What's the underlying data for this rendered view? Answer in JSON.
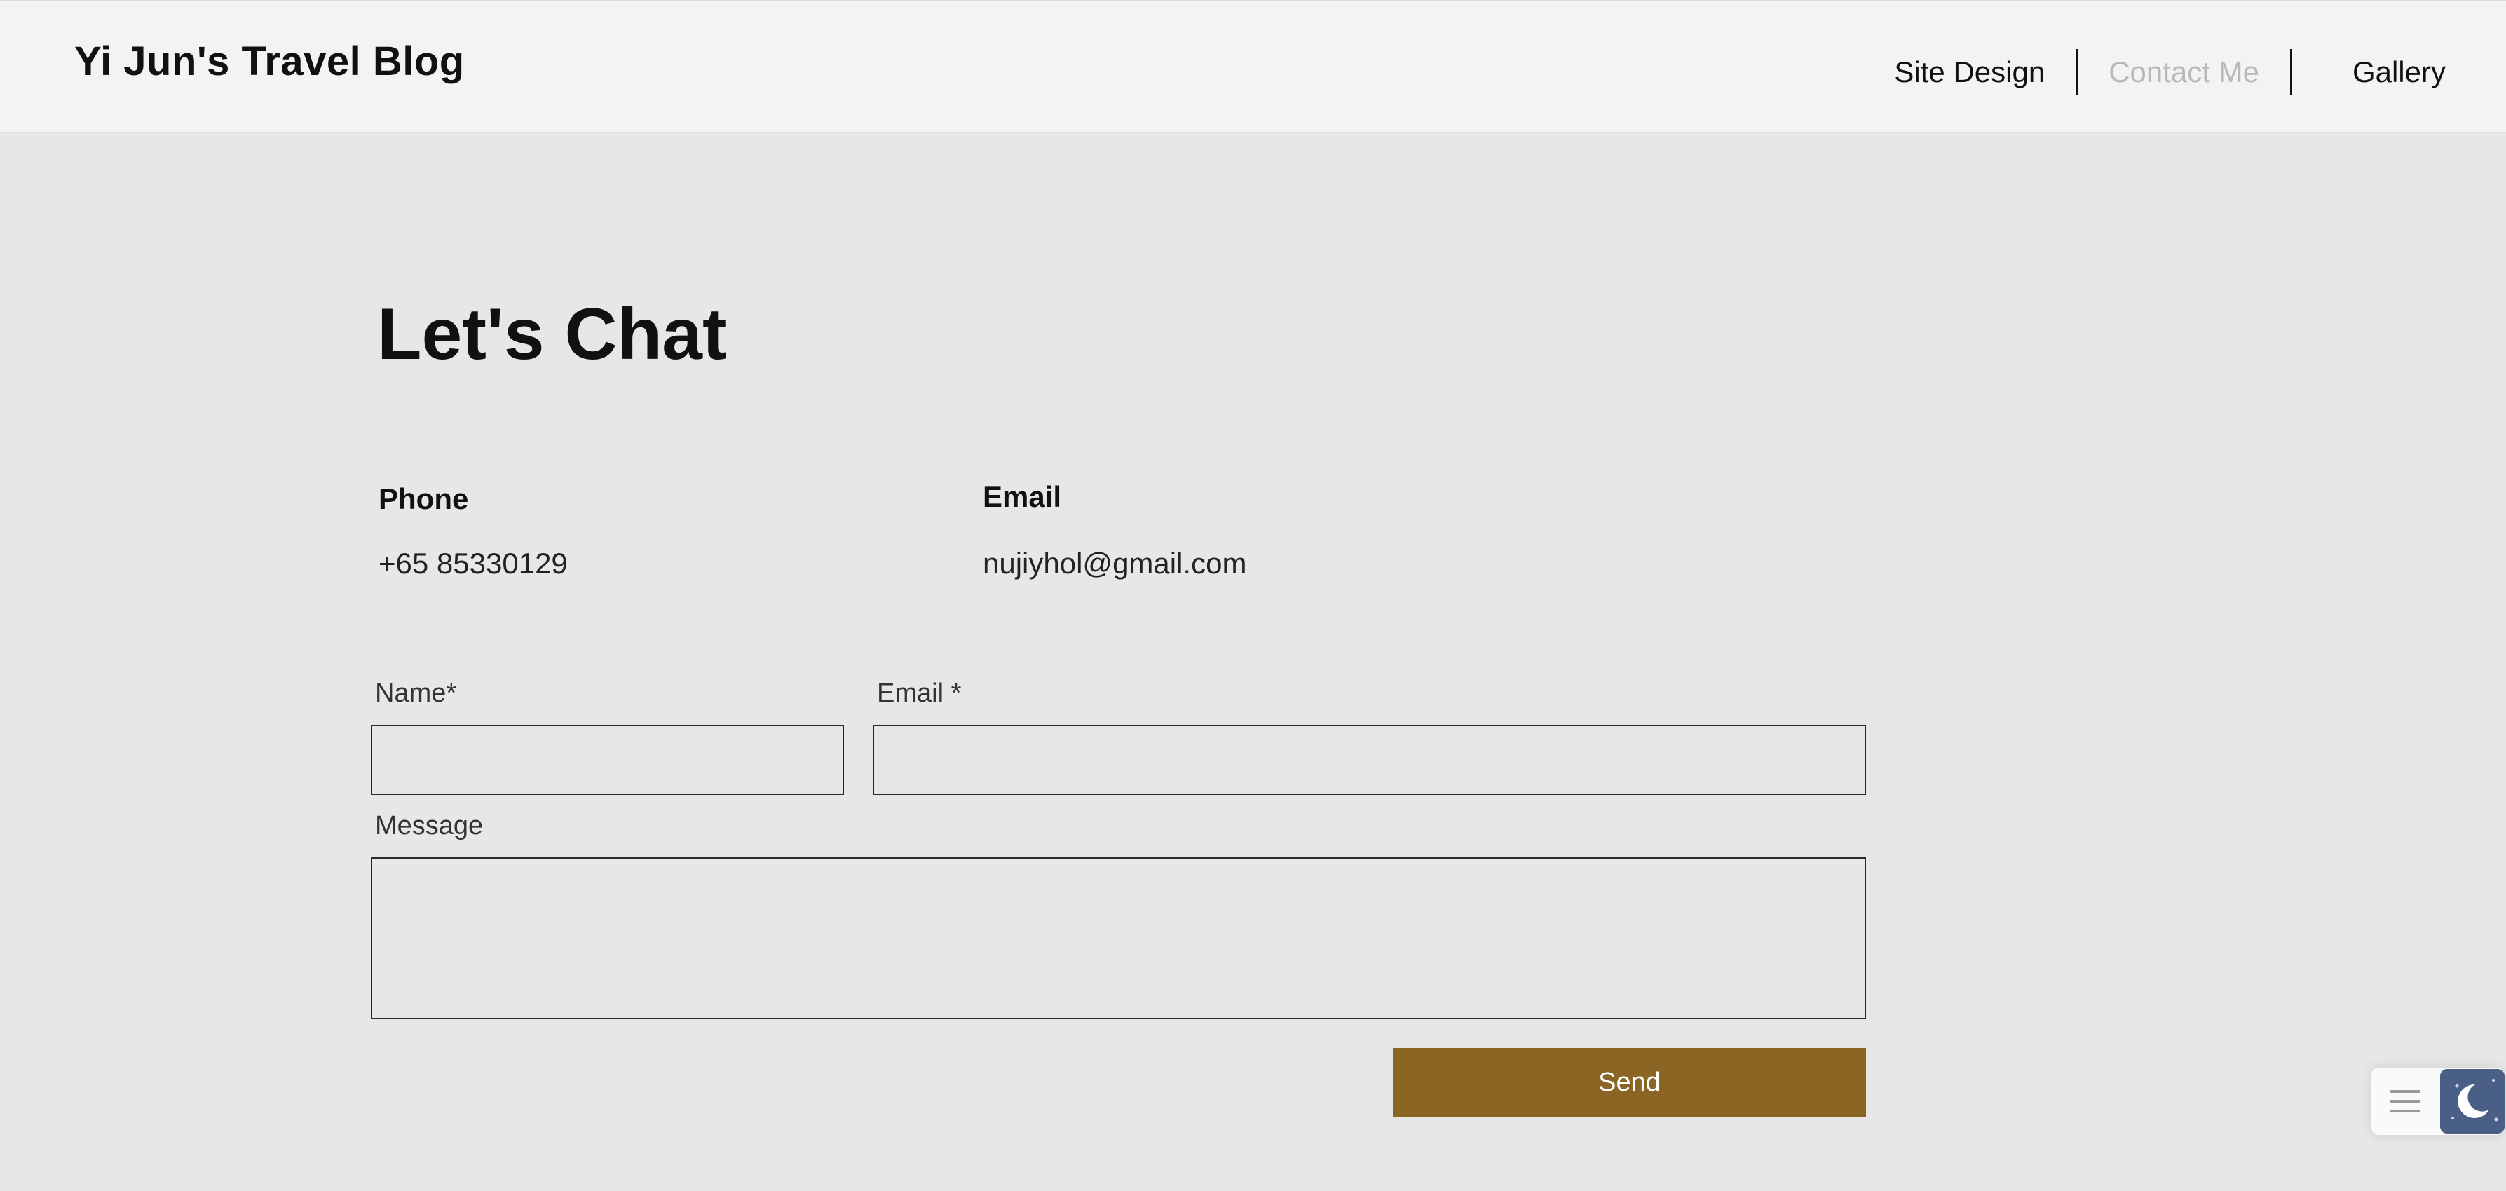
{
  "header": {
    "site_title": "Yi Jun's Travel Blog",
    "nav": [
      {
        "label": "Site Design",
        "active": false
      },
      {
        "label": "Contact Me",
        "active": true
      },
      {
        "label": "Gallery",
        "active": false
      }
    ]
  },
  "main": {
    "title": "Let's Chat",
    "phone": {
      "heading": "Phone",
      "value": "+65 85330129"
    },
    "email": {
      "heading": "Email",
      "value": "nujiyhol@gmail.com"
    }
  },
  "form": {
    "name_label": "Name*",
    "name_value": "",
    "email_label": "Email *",
    "email_value": "",
    "message_label": "Message",
    "message_value": "",
    "send_label": "Send"
  },
  "widgets": {
    "menu_icon": "hamburger-icon",
    "dark_mode_icon": "moon-icon"
  },
  "colors": {
    "page_background": "#e7e7e7",
    "header_background": "#f3f3f3",
    "send_button": "#8b6523",
    "active_nav": "#b9b9b9",
    "dark_mode_button": "#4a5f86"
  }
}
